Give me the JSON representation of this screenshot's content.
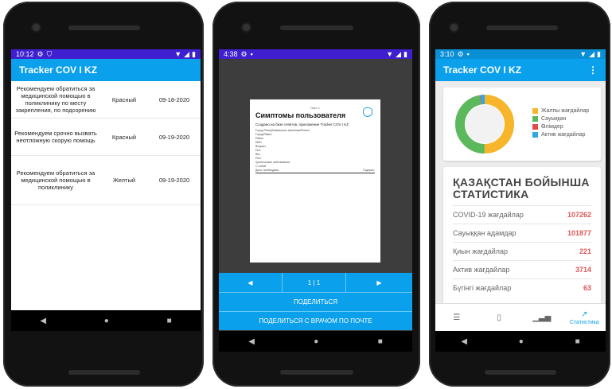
{
  "phone1": {
    "status": {
      "time": "10:12",
      "icons": [
        "gear-icon",
        "shield-icon"
      ],
      "right_icons": [
        "wifi-icon",
        "signal-icon",
        "battery-icon"
      ]
    },
    "app_title": "Tracker COV I KZ",
    "rows": [
      {
        "message": "Рекомендуем обратиться за медицинской помощью в поликлинику по месту закрепления, по подозрению",
        "level": "Красный",
        "date": "09-18-2020"
      },
      {
        "message": "Рекомендуем срочно вызвать неотложную скорую помощь",
        "level": "Красный",
        "date": "09-19-2020"
      },
      {
        "message": "Рекомендуем обратиться за медицинской помощью в поликлинику",
        "level": "Желтый",
        "date": "09-19-2020"
      }
    ]
  },
  "phone2": {
    "status": {
      "time": "4:38",
      "icons": [
        "gear-icon",
        "document-icon"
      ],
      "right_icons": [
        "wifi-icon",
        "signal-icon",
        "battery-icon"
      ]
    },
    "pdf": {
      "page_marker": "Лист 1",
      "title": "Симптомы пользователя",
      "subtitle": "Создано на базе ответов, приложение Tracker COV I KZ",
      "lines": [
        "Город Республиканского значения/Регион",
        "Город/Район",
        "Район",
        "ИИН",
        "Возраст",
        "Пол",
        "Вес",
        "Рост",
        "Хронические заболевания",
        "С собой"
      ],
      "footer_left": "Дата: необходимо",
      "footer_right": "Подпись:"
    },
    "pager": {
      "prev": "◀",
      "info": "1 | 1",
      "next": "▶"
    },
    "share_label": "ПОДЕЛИТЬСЯ",
    "share_doctor_label": "ПОДЕЛИТЬСЯ С ВРАЧОМ ПО ПОЧТЕ"
  },
  "phone3": {
    "status": {
      "time": "3:10",
      "icons": [
        "gear-icon",
        "document-icon"
      ],
      "right_icons": [
        "wifi-icon",
        "signal-icon",
        "battery-icon"
      ]
    },
    "app_title": "Tracker COV I KZ",
    "legend": [
      {
        "label": "Жалпы жағдайлар",
        "color": "#f7b52c"
      },
      {
        "label": "Сауыққан",
        "color": "#5cb85c"
      },
      {
        "label": "Өлімдер",
        "color": "#e34a4a"
      },
      {
        "label": "Актив жағдайлар",
        "color": "#2fa7e3"
      }
    ],
    "donut_shares": {
      "total": 0.5,
      "recovered": 0.47,
      "deaths": 0.005,
      "active": 0.025
    },
    "stat_title": "ҚАЗАҚСТАН БОЙЫНША СТАТИСТИКА",
    "stats": [
      {
        "label": "COVID-19 жағдайлар",
        "value": "107262"
      },
      {
        "label": "Сауыққан адамдар",
        "value": "101877"
      },
      {
        "label": "Қиын жағдайлар",
        "value": "221"
      },
      {
        "label": "Актив жағдайлар",
        "value": "3714"
      },
      {
        "label": "Бүгінгі жағдайлар",
        "value": "63"
      }
    ],
    "bottom_nav": [
      {
        "icon": "menu-icon",
        "label": ""
      },
      {
        "icon": "phone-icon",
        "label": ""
      },
      {
        "icon": "bar-chart-icon",
        "label": ""
      },
      {
        "icon": "trending-up-icon",
        "label": "Статистика"
      }
    ]
  },
  "system_nav": {
    "back": "◀",
    "home": "●",
    "recents": "■"
  }
}
